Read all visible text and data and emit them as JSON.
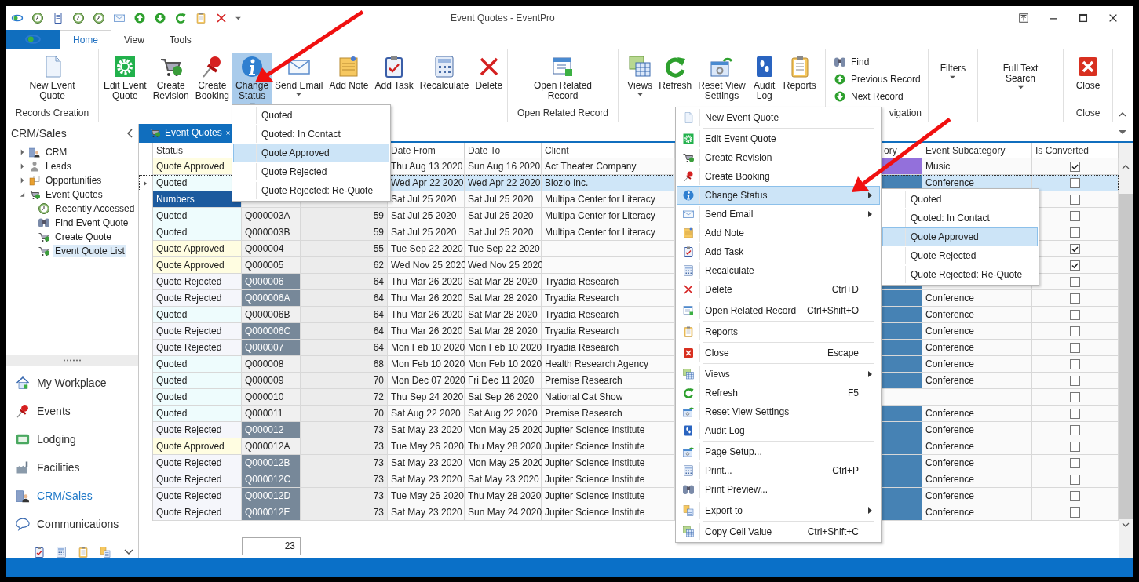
{
  "window": {
    "title": "Event Quotes - EventPro"
  },
  "ribbon_tabs": [
    {
      "label": "Home",
      "selected": true
    },
    {
      "label": "View",
      "selected": false
    },
    {
      "label": "Tools",
      "selected": false
    }
  ],
  "ribbon": {
    "groups": [
      {
        "label": "Records Creation",
        "buttons": [
          {
            "kind": "large",
            "label": "New Event\nQuote",
            "pressed": false
          }
        ]
      },
      {
        "buttons": [
          {
            "kind": "large",
            "label": "Edit Event\nQuote",
            "pressed": false
          },
          {
            "kind": "large",
            "label": "Create\nRevision",
            "pressed": false
          },
          {
            "kind": "large",
            "label": "Create\nBooking",
            "pressed": false
          },
          {
            "kind": "large",
            "label": "Change\nStatus",
            "pressed": true,
            "dropdown": true
          },
          {
            "kind": "large",
            "label": "Send Email",
            "pressed": false,
            "dropdown": true
          },
          {
            "kind": "large",
            "label": "Add Note",
            "pressed": false
          },
          {
            "kind": "large",
            "label": "Add Task",
            "pressed": false
          },
          {
            "kind": "large",
            "label": "Recalculate",
            "pressed": false
          },
          {
            "kind": "large",
            "label": "Delete",
            "pressed": false
          }
        ]
      },
      {
        "label": "Open Related Record",
        "buttons": [
          {
            "kind": "large",
            "label": "Open Related\nRecord",
            "pressed": false
          }
        ]
      },
      {
        "buttons": [
          {
            "kind": "large",
            "label": "Views",
            "pressed": false,
            "dropdown": true
          },
          {
            "kind": "large",
            "label": "Refresh",
            "pressed": false
          },
          {
            "kind": "large",
            "label": "Reset View\nSettings",
            "pressed": false
          },
          {
            "kind": "large",
            "label": "Audit\nLog",
            "pressed": false
          },
          {
            "kind": "large",
            "label": "Reports",
            "pressed": false
          }
        ]
      },
      {
        "label": "vigation",
        "buttons": [
          {
            "kind": "small",
            "label": "Find",
            "pressed": false
          },
          {
            "kind": "small",
            "label": "Previous Record",
            "pressed": false
          },
          {
            "kind": "small",
            "label": "Next Record",
            "pressed": false
          }
        ]
      },
      {
        "buttons": [
          {
            "kind": "text",
            "label": "Filters",
            "pressed": false,
            "dropdown": true
          }
        ]
      },
      {
        "buttons": [
          {
            "kind": "text",
            "label": "Full Text\nSearch",
            "pressed": false,
            "dropdown": true
          }
        ]
      },
      {
        "label": "Close",
        "buttons": [
          {
            "kind": "large",
            "label": "Close",
            "pressed": false
          }
        ]
      }
    ]
  },
  "sidebar": {
    "title": "CRM/Sales",
    "tree": [
      {
        "label": "CRM",
        "expanded": false,
        "selected": false
      },
      {
        "label": "Leads",
        "expanded": false,
        "selected": false
      },
      {
        "label": "Opportunities",
        "expanded": false,
        "selected": false
      },
      {
        "label": "Event Quotes",
        "expanded": true,
        "selected": false,
        "children": [
          {
            "label": "Recently Accessed",
            "selected": false
          },
          {
            "label": "Find Event Quote",
            "selected": false
          },
          {
            "label": "Create Quote",
            "selected": false
          },
          {
            "label": "Event Quote List",
            "selected": true
          }
        ]
      }
    ],
    "nav": [
      {
        "label": "My Workplace",
        "selected": false
      },
      {
        "label": "Events",
        "selected": false
      },
      {
        "label": "Lodging",
        "selected": false
      },
      {
        "label": "Facilities",
        "selected": false
      },
      {
        "label": "CRM/Sales",
        "selected": true
      },
      {
        "label": "Communications",
        "selected": false
      }
    ]
  },
  "document_tab": {
    "label": "Event Quotes",
    "selected": true
  },
  "table": {
    "columns": [
      "Status",
      "Date From",
      "Date To",
      "Client",
      "ory",
      "Event Subcategory",
      "Is Converted"
    ],
    "rows": [
      {
        "status": {
          "text": "Quote Approved",
          "color": "#fffde1"
        },
        "from": "Thu Aug 13 2020",
        "to": "Sun Aug 16 2020",
        "client": "Act Theater Company",
        "category": {
          "color": "#9370db"
        },
        "subcategory": "Music",
        "converted": true,
        "selected": false
      },
      {
        "status": {
          "text": "Quoted",
          "color": "#eefcfd"
        },
        "from": "Wed Apr 22 2020",
        "to": "Wed Apr 22 2020",
        "client": "Biozio Inc.",
        "category": {
          "color": "#4682b4"
        },
        "subcategory": "Conference",
        "converted": false,
        "selected": true
      },
      {
        "status": {
          "text": "Numbers",
          "color": "#1c5a9e"
        },
        "from": "Sat Jul 25 2020",
        "to": "Sat Jul 25 2020",
        "client": "Multipa Center for Literacy",
        "converted": false,
        "selected": false
      },
      {
        "status": {
          "text": "Quoted",
          "color": "#eefcfd"
        },
        "number": {
          "text": "Q000003A"
        },
        "amount": "59",
        "from": "Sat Jul 25 2020",
        "to": "Sat Jul 25 2020",
        "client": "Multipa Center for Literacy",
        "converted": false,
        "selected": false
      },
      {
        "status": {
          "text": "Quoted",
          "color": "#eefcfd"
        },
        "number": {
          "text": "Q000003B"
        },
        "amount": "59",
        "from": "Sat Jul 25 2020",
        "to": "Sat Jul 25 2020",
        "client": "Multipa Center for Literacy",
        "converted": false,
        "selected": false
      },
      {
        "status": {
          "text": "Quote Approved",
          "color": "#fffde1"
        },
        "number": {
          "text": "Q000004"
        },
        "amount": "55",
        "from": "Tue Sep 22 2020",
        "to": "Tue Sep 22 2020",
        "converted": true,
        "selected": false
      },
      {
        "status": {
          "text": "Quote Approved",
          "color": "#fffde1"
        },
        "number": {
          "text": "Q000005"
        },
        "amount": "62",
        "from": "Wed Nov 25 2020",
        "to": "Wed Nov 25 2020",
        "converted": true,
        "selected": false
      },
      {
        "status": {
          "text": "Quote Rejected",
          "color": "#f5f6fb"
        },
        "number": {
          "text": "Q000006",
          "color": "#778899"
        },
        "amount": "64",
        "from": "Thu Mar 26 2020",
        "to": "Sat Mar 28 2020",
        "client": "Tryadia Research",
        "category": {
          "color": "#4682b4"
        },
        "converted": false,
        "selected": false
      },
      {
        "status": {
          "text": "Quote Rejected",
          "color": "#f5f6fb"
        },
        "number": {
          "text": "Q000006A",
          "color": "#778899"
        },
        "amount": "64",
        "from": "Thu Mar 26 2020",
        "to": "Sat Mar 28 2020",
        "client": "Tryadia Research",
        "category": {
          "color": "#4682b4"
        },
        "subcategory": "Conference",
        "converted": false,
        "selected": false
      },
      {
        "status": {
          "text": "Quoted",
          "color": "#eefcfd"
        },
        "number": {
          "text": "Q000006B"
        },
        "amount": "64",
        "from": "Thu Mar 26 2020",
        "to": "Sat Mar 28 2020",
        "client": "Tryadia Research",
        "category": {
          "color": "#4682b4"
        },
        "subcategory": "Conference",
        "converted": false,
        "selected": false
      },
      {
        "status": {
          "text": "Quote Rejected",
          "color": "#f5f6fb"
        },
        "number": {
          "text": "Q000006C",
          "color": "#778899"
        },
        "amount": "64",
        "from": "Thu Mar 26 2020",
        "to": "Sat Mar 28 2020",
        "client": "Tryadia Research",
        "category": {
          "color": "#4682b4"
        },
        "subcategory": "Conference",
        "converted": false,
        "selected": false
      },
      {
        "status": {
          "text": "Quote Rejected",
          "color": "#f5f6fb"
        },
        "number": {
          "text": "Q000007",
          "color": "#778899"
        },
        "amount": "64",
        "from": "Mon Feb 10 2020",
        "to": "Mon Feb 10 2020",
        "client": "Tryadia Research",
        "category": {
          "color": "#4682b4"
        },
        "subcategory": "Conference",
        "converted": false,
        "selected": false
      },
      {
        "status": {
          "text": "Quoted",
          "color": "#eefcfd"
        },
        "number": {
          "text": "Q000008"
        },
        "amount": "68",
        "from": "Mon Feb 10 2020",
        "to": "Mon Feb 10 2020",
        "client": "Health Research Agency",
        "category": {
          "color": "#4682b4"
        },
        "subcategory": "Conference",
        "converted": false,
        "selected": false
      },
      {
        "status": {
          "text": "Quoted",
          "color": "#eefcfd"
        },
        "number": {
          "text": "Q000009"
        },
        "amount": "70",
        "from": "Mon Dec 07 2020",
        "to": "Fri Dec 11 2020",
        "client": "Premise Research",
        "category": {
          "color": "#4682b4"
        },
        "subcategory": "Conference",
        "converted": false,
        "selected": false
      },
      {
        "status": {
          "text": "Quoted",
          "color": "#eefcfd"
        },
        "number": {
          "text": "Q000010"
        },
        "amount": "72",
        "from": "Thu Sep 24 2020",
        "to": "Sat Sep 26 2020",
        "client": "National Cat Show",
        "converted": false,
        "selected": false
      },
      {
        "status": {
          "text": "Quoted",
          "color": "#eefcfd"
        },
        "number": {
          "text": "Q000011"
        },
        "amount": "70",
        "from": "Sat Aug 22 2020",
        "to": "Sat Aug 22 2020",
        "client": "Premise Research",
        "category": {
          "color": "#4682b4"
        },
        "subcategory": "Conference",
        "converted": false,
        "selected": false
      },
      {
        "status": {
          "text": "Quote Rejected",
          "color": "#f5f6fb"
        },
        "number": {
          "text": "Q000012",
          "color": "#778899"
        },
        "amount": "73",
        "from": "Sat May 23 2020",
        "to": "Mon May 25 2020",
        "client": "Jupiter Science Institute",
        "category": {
          "color": "#4682b4"
        },
        "subcategory": "Conference",
        "converted": false,
        "selected": false
      },
      {
        "status": {
          "text": "Quote Approved",
          "color": "#fffde1"
        },
        "number": {
          "text": "Q000012A"
        },
        "amount": "73",
        "from": "Tue May 26 2020",
        "to": "Thu May 28 2020",
        "client": "Jupiter Science Institute",
        "category": {
          "color": "#4682b4"
        },
        "subcategory": "Conference",
        "converted": false,
        "selected": false
      },
      {
        "status": {
          "text": "Quote Rejected",
          "color": "#f5f6fb"
        },
        "number": {
          "text": "Q000012B",
          "color": "#778899"
        },
        "amount": "73",
        "from": "Sat May 23 2020",
        "to": "Mon May 25 2020",
        "client": "Jupiter Science Institute",
        "category": {
          "color": "#4682b4"
        },
        "subcategory": "Conference",
        "converted": false,
        "selected": false
      },
      {
        "status": {
          "text": "Quote Rejected",
          "color": "#f5f6fb"
        },
        "number": {
          "text": "Q000012C",
          "color": "#778899"
        },
        "amount": "73",
        "from": "Sat May 23 2020",
        "to": "Sat May 23 2020",
        "client": "Jupiter Science Institute",
        "category": {
          "color": "#4682b4"
        },
        "subcategory": "Conference",
        "converted": false,
        "selected": false
      },
      {
        "status": {
          "text": "Quote Rejected",
          "color": "#f5f6fb"
        },
        "number": {
          "text": "Q000012D",
          "color": "#778899"
        },
        "amount": "73",
        "from": "Tue May 26 2020",
        "to": "Thu May 28 2020",
        "client": "Jupiter Science Institute",
        "category": {
          "color": "#4682b4"
        },
        "subcategory": "Conference",
        "converted": false,
        "selected": false
      },
      {
        "status": {
          "text": "Quote Rejected",
          "color": "#f5f6fb"
        },
        "number": {
          "text": "Q000012E",
          "color": "#778899"
        },
        "amount": "73",
        "from": "Sat May 23 2020",
        "to": "Sun May 24 2020",
        "client": "Jupiter Science Institute",
        "category": {
          "color": "#4682b4"
        },
        "subcategory": "Conference",
        "converted": false,
        "selected": false
      }
    ],
    "summary": "23"
  },
  "status_dropdown": {
    "items": [
      {
        "label": "Quoted",
        "selected": false
      },
      {
        "label": "Quoted: In Contact",
        "selected": false
      },
      {
        "label": "Quote Approved",
        "selected": true
      },
      {
        "label": "Quote Rejected",
        "selected": false
      },
      {
        "label": "Quote Rejected: Re-Quote",
        "selected": false
      }
    ]
  },
  "context_menu": {
    "items": [
      {
        "label": "New Event Quote",
        "selected": false
      },
      {
        "label": "Edit Event Quote",
        "separator_before": true,
        "selected": false
      },
      {
        "label": "Create Revision",
        "selected": false
      },
      {
        "label": "Create Booking",
        "selected": false
      },
      {
        "label": "Change Status",
        "submenu": true,
        "selected": true
      },
      {
        "label": "Send Email",
        "submenu": true,
        "selected": false
      },
      {
        "label": "Add Note",
        "selected": false
      },
      {
        "label": "Add Task",
        "selected": false
      },
      {
        "label": "Recalculate",
        "selected": false
      },
      {
        "label": "Delete",
        "shortcut": "Ctrl+D",
        "selected": false
      },
      {
        "label": "Open Related Record",
        "shortcut": "Ctrl+Shift+O",
        "separator_before": true,
        "selected": false
      },
      {
        "label": "Reports",
        "separator_before": true,
        "selected": false
      },
      {
        "label": "Close",
        "shortcut": "Escape",
        "separator_before": true,
        "selected": false
      },
      {
        "label": "Views",
        "submenu": true,
        "separator_before": true,
        "selected": false
      },
      {
        "label": "Refresh",
        "shortcut": "F5",
        "selected": false
      },
      {
        "label": "Reset View Settings",
        "selected": false
      },
      {
        "label": "Audit Log",
        "selected": false
      },
      {
        "label": "Page Setup...",
        "separator_before": true,
        "selected": false
      },
      {
        "label": "Print...",
        "shortcut": "Ctrl+P",
        "selected": false
      },
      {
        "label": "Print Preview...",
        "selected": false
      },
      {
        "label": "Export to",
        "submenu": true,
        "separator_before": true,
        "selected": false
      },
      {
        "label": "Copy Cell Value",
        "shortcut": "Ctrl+Shift+C",
        "separator_before": true,
        "selected": false
      }
    ]
  },
  "status_submenu": {
    "items": [
      {
        "label": "Quoted",
        "selected": false
      },
      {
        "label": "Quoted: In Contact",
        "selected": false
      },
      {
        "label": "Quote Approved",
        "selected": true
      },
      {
        "label": "Quote Rejected",
        "selected": false
      },
      {
        "label": "Quote Rejected: Re-Quote",
        "selected": false
      }
    ]
  }
}
